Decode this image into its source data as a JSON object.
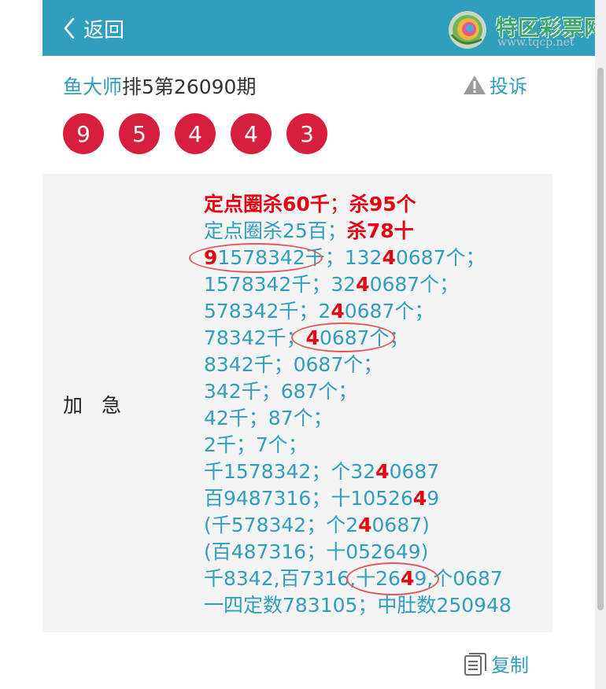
{
  "header": {
    "back_label": "返回",
    "brand_name": "特区彩票网",
    "brand_url": "www.tqcp.net"
  },
  "post": {
    "author": "鱼大师",
    "title": "排5第26090期",
    "complain_label": "投诉"
  },
  "draw_numbers": [
    "9",
    "5",
    "4",
    "4",
    "3"
  ],
  "panel": {
    "side_label": "加急",
    "lines": [
      {
        "type": "strong",
        "parts": [
          {
            "t": "定点圈杀60千"
          },
          {
            "t": "；",
            "plain": true
          },
          {
            "t": "杀95个"
          }
        ]
      },
      {
        "type": "mixed",
        "parts": [
          {
            "t": "定点圈杀25百；"
          },
          {
            "t": "杀78十",
            "red": true
          }
        ]
      },
      {
        "type": "mixed",
        "parts": [
          {
            "t": "9",
            "hl": true
          },
          {
            "t": "1578342千；132"
          },
          {
            "t": "4",
            "hl": true
          },
          {
            "t": "0687个；"
          }
        ]
      },
      {
        "type": "mixed",
        "parts": [
          {
            "t": "1578342千；32"
          },
          {
            "t": "4",
            "hl": true
          },
          {
            "t": "0687个；"
          }
        ]
      },
      {
        "type": "mixed",
        "parts": [
          {
            "t": "578342千；2"
          },
          {
            "t": "4",
            "hl": true
          },
          {
            "t": "0687个；"
          }
        ]
      },
      {
        "type": "mixed",
        "parts": [
          {
            "t": "78342千；"
          },
          {
            "t": "4",
            "hl": true
          },
          {
            "t": "0687个；"
          }
        ]
      },
      {
        "type": "mixed",
        "parts": [
          {
            "t": "8342千；0687个；"
          }
        ]
      },
      {
        "type": "mixed",
        "parts": [
          {
            "t": "342千；687个；"
          }
        ]
      },
      {
        "type": "mixed",
        "parts": [
          {
            "t": "42千；87个；"
          }
        ]
      },
      {
        "type": "mixed",
        "parts": [
          {
            "t": "2千；7个；"
          }
        ]
      },
      {
        "type": "mixed",
        "parts": [
          {
            "t": "千1578342；个32"
          },
          {
            "t": "4",
            "hl": true
          },
          {
            "t": "0687"
          }
        ]
      },
      {
        "type": "mixed",
        "parts": [
          {
            "t": "百9487316；十10526"
          },
          {
            "t": "4",
            "hl": true
          },
          {
            "t": "9"
          }
        ]
      },
      {
        "type": "mixed",
        "parts": [
          {
            "t": "(千578342；个2"
          },
          {
            "t": "4",
            "hl": true
          },
          {
            "t": "0687)"
          }
        ]
      },
      {
        "type": "mixed",
        "parts": [
          {
            "t": "(百487316；十05264"
          },
          {
            "t": "9)"
          }
        ]
      },
      {
        "type": "mixed",
        "parts": [
          {
            "t": "千8342,百7316,十26"
          },
          {
            "t": "4",
            "hl": true
          },
          {
            "t": "9,个0687"
          }
        ]
      },
      {
        "type": "mixed",
        "parts": [
          {
            "t": "一四定数783105；中肚数250948"
          }
        ]
      }
    ]
  },
  "footer": {
    "copy_label": "复制"
  },
  "colors": {
    "accent": "#2f9fbd",
    "ball": "#d81e3f",
    "highlight": "#e60012"
  }
}
